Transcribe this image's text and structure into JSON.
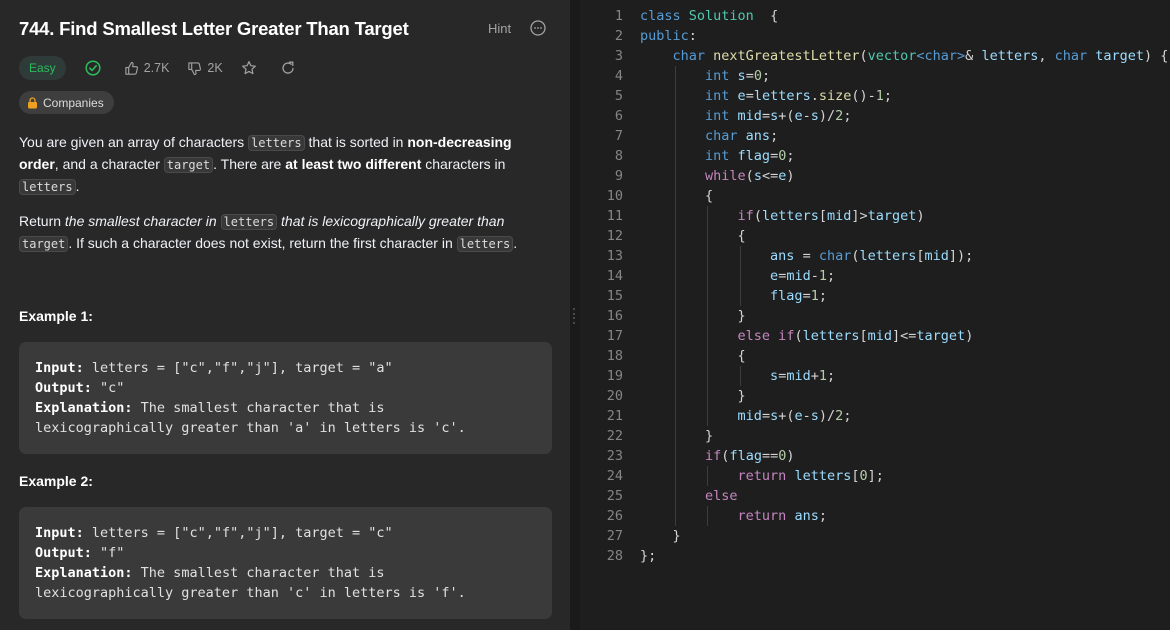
{
  "problem": {
    "title": "744. Find Smallest Letter Greater Than Target",
    "hint_label": "Hint",
    "difficulty": "Easy",
    "likes": "2.7K",
    "dislikes": "2K",
    "companies_label": "Companies",
    "description": {
      "p1_a": "You are given an array of characters ",
      "p1_code1": "letters",
      "p1_b": " that is sorted in ",
      "p1_bold1": "non-decreasing order",
      "p1_c": ", and a character ",
      "p1_code2": "target",
      "p1_d": ". There are ",
      "p1_bold2": "at least two different",
      "p1_e": " characters in ",
      "p1_code3": "letters",
      "p1_f": ".",
      "p2_a": "Return ",
      "p2_i1": "the smallest character in ",
      "p2_code1": "letters",
      "p2_i2": " that is lexicographically greater than ",
      "p2_code2": "target",
      "p2_b": ". If such a character does not exist, return the first character in ",
      "p2_code3": "letters",
      "p2_c": "."
    },
    "examples": [
      {
        "title": "Example 1:",
        "input_label": "Input:",
        "input": " letters = [\"c\",\"f\",\"j\"], target = \"a\"",
        "output_label": "Output:",
        "output": " \"c\"",
        "explanation_label": "Explanation:",
        "explanation_1": " The smallest character that is",
        "explanation_2": "lexicographically greater than 'a' in letters is 'c'."
      },
      {
        "title": "Example 2:",
        "input_label": "Input:",
        "input": " letters = [\"c\",\"f\",\"j\"], target = \"c\"",
        "output_label": "Output:",
        "output": " \"f\"",
        "explanation_label": "Explanation:",
        "explanation_1": " The smallest character that is",
        "explanation_2": "lexicographically greater than 'c' in letters is 'f'."
      }
    ]
  },
  "editor": {
    "lines": [
      {
        "n": "1",
        "indent": 0,
        "t": [
          [
            "kw",
            "class "
          ],
          [
            "ty",
            "Solution"
          ],
          [
            "",
            "  {"
          ]
        ]
      },
      {
        "n": "2",
        "indent": 0,
        "t": [
          [
            "kw",
            "public"
          ],
          [
            "",
            ":"
          ]
        ]
      },
      {
        "n": "3",
        "indent": 1,
        "t": [
          [
            "kw",
            "char "
          ],
          [
            "fn",
            "nextGreatestLetter"
          ],
          [
            "",
            "("
          ],
          [
            "ty",
            "vector"
          ],
          [
            "kw",
            "<char>"
          ],
          [
            "",
            "& "
          ],
          [
            "vr",
            "letters"
          ],
          [
            "",
            ", "
          ],
          [
            "kw",
            "char "
          ],
          [
            "vr",
            "target"
          ],
          [
            "",
            ") {"
          ]
        ]
      },
      {
        "n": "4",
        "indent": 2,
        "t": [
          [
            "kw",
            "int "
          ],
          [
            "vr",
            "s"
          ],
          [
            "",
            "="
          ],
          [
            "nm",
            "0"
          ],
          [
            "",
            ";"
          ]
        ]
      },
      {
        "n": "5",
        "indent": 2,
        "t": [
          [
            "kw",
            "int "
          ],
          [
            "vr",
            "e"
          ],
          [
            "",
            "="
          ],
          [
            "vr",
            "letters"
          ],
          [
            "",
            "."
          ],
          [
            "fn",
            "size"
          ],
          [
            "",
            "()-"
          ],
          [
            "nm",
            "1"
          ],
          [
            "",
            ";"
          ]
        ]
      },
      {
        "n": "6",
        "indent": 2,
        "t": [
          [
            "kw",
            "int "
          ],
          [
            "vr",
            "mid"
          ],
          [
            "",
            "="
          ],
          [
            "vr",
            "s"
          ],
          [
            "",
            "+("
          ],
          [
            "vr",
            "e"
          ],
          [
            "",
            "-"
          ],
          [
            "vr",
            "s"
          ],
          [
            "",
            ")/"
          ],
          [
            "nm",
            "2"
          ],
          [
            "",
            ";"
          ]
        ]
      },
      {
        "n": "7",
        "indent": 2,
        "t": [
          [
            "kw",
            "char "
          ],
          [
            "vr",
            "ans"
          ],
          [
            "",
            ";"
          ]
        ]
      },
      {
        "n": "8",
        "indent": 2,
        "t": [
          [
            "kw",
            "int "
          ],
          [
            "vr",
            "flag"
          ],
          [
            "",
            "="
          ],
          [
            "nm",
            "0"
          ],
          [
            "",
            ";"
          ]
        ]
      },
      {
        "n": "9",
        "indent": 2,
        "t": [
          [
            "ct",
            "while"
          ],
          [
            "",
            "("
          ],
          [
            "vr",
            "s"
          ],
          [
            "",
            "<="
          ],
          [
            "vr",
            "e"
          ],
          [
            "",
            ")"
          ]
        ]
      },
      {
        "n": "10",
        "indent": 2,
        "t": [
          [
            "",
            "{"
          ]
        ]
      },
      {
        "n": "11",
        "indent": 3,
        "t": [
          [
            "ct",
            "if"
          ],
          [
            "",
            "("
          ],
          [
            "vr",
            "letters"
          ],
          [
            "",
            "["
          ],
          [
            "vr",
            "mid"
          ],
          [
            "",
            "]>"
          ],
          [
            "vr",
            "target"
          ],
          [
            "",
            ")"
          ]
        ]
      },
      {
        "n": "12",
        "indent": 3,
        "t": [
          [
            "",
            "{"
          ]
        ]
      },
      {
        "n": "13",
        "indent": 4,
        "t": [
          [
            "vr",
            "ans"
          ],
          [
            "",
            " = "
          ],
          [
            "kw",
            "char"
          ],
          [
            "",
            "("
          ],
          [
            "vr",
            "letters"
          ],
          [
            "",
            "["
          ],
          [
            "vr",
            "mid"
          ],
          [
            "",
            "]);"
          ]
        ]
      },
      {
        "n": "14",
        "indent": 4,
        "t": [
          [
            "vr",
            "e"
          ],
          [
            "",
            "="
          ],
          [
            "vr",
            "mid"
          ],
          [
            "",
            "-"
          ],
          [
            "nm",
            "1"
          ],
          [
            "",
            ";"
          ]
        ]
      },
      {
        "n": "15",
        "indent": 4,
        "t": [
          [
            "vr",
            "flag"
          ],
          [
            "",
            "="
          ],
          [
            "nm",
            "1"
          ],
          [
            "",
            ";"
          ]
        ]
      },
      {
        "n": "16",
        "indent": 3,
        "t": [
          [
            "",
            "}"
          ]
        ]
      },
      {
        "n": "17",
        "indent": 3,
        "t": [
          [
            "ct",
            "else if"
          ],
          [
            "",
            "("
          ],
          [
            "vr",
            "letters"
          ],
          [
            "",
            "["
          ],
          [
            "vr",
            "mid"
          ],
          [
            "",
            "]<="
          ],
          [
            "vr",
            "target"
          ],
          [
            "",
            ")"
          ]
        ]
      },
      {
        "n": "18",
        "indent": 3,
        "t": [
          [
            "",
            "{"
          ]
        ]
      },
      {
        "n": "19",
        "indent": 4,
        "t": [
          [
            "vr",
            "s"
          ],
          [
            "",
            "="
          ],
          [
            "vr",
            "mid"
          ],
          [
            "",
            "+"
          ],
          [
            "nm",
            "1"
          ],
          [
            "",
            ";"
          ]
        ]
      },
      {
        "n": "20",
        "indent": 3,
        "t": [
          [
            "",
            "}"
          ]
        ]
      },
      {
        "n": "21",
        "indent": 3,
        "t": [
          [
            "vr",
            "mid"
          ],
          [
            "",
            "="
          ],
          [
            "vr",
            "s"
          ],
          [
            "",
            "+("
          ],
          [
            "vr",
            "e"
          ],
          [
            "",
            "-"
          ],
          [
            "vr",
            "s"
          ],
          [
            "",
            ")/"
          ],
          [
            "nm",
            "2"
          ],
          [
            "",
            ";"
          ]
        ]
      },
      {
        "n": "22",
        "indent": 2,
        "t": [
          [
            "",
            "}"
          ]
        ]
      },
      {
        "n": "23",
        "indent": 2,
        "t": [
          [
            "ct",
            "if"
          ],
          [
            "",
            "("
          ],
          [
            "vr",
            "flag"
          ],
          [
            "",
            "=="
          ],
          [
            "nm",
            "0"
          ],
          [
            "",
            ")"
          ]
        ]
      },
      {
        "n": "24",
        "indent": 3,
        "t": [
          [
            "ct",
            "return "
          ],
          [
            "vr",
            "letters"
          ],
          [
            "",
            "["
          ],
          [
            "nm",
            "0"
          ],
          [
            "",
            "];"
          ]
        ]
      },
      {
        "n": "25",
        "indent": 2,
        "t": [
          [
            "ct",
            "else"
          ]
        ]
      },
      {
        "n": "26",
        "indent": 3,
        "t": [
          [
            "ct",
            "return "
          ],
          [
            "vr",
            "ans"
          ],
          [
            "",
            ";"
          ]
        ]
      },
      {
        "n": "27",
        "indent": 1,
        "t": [
          [
            "",
            "}"
          ]
        ]
      },
      {
        "n": "28",
        "indent": 0,
        "t": [
          [
            "",
            "};"
          ]
        ]
      }
    ]
  }
}
